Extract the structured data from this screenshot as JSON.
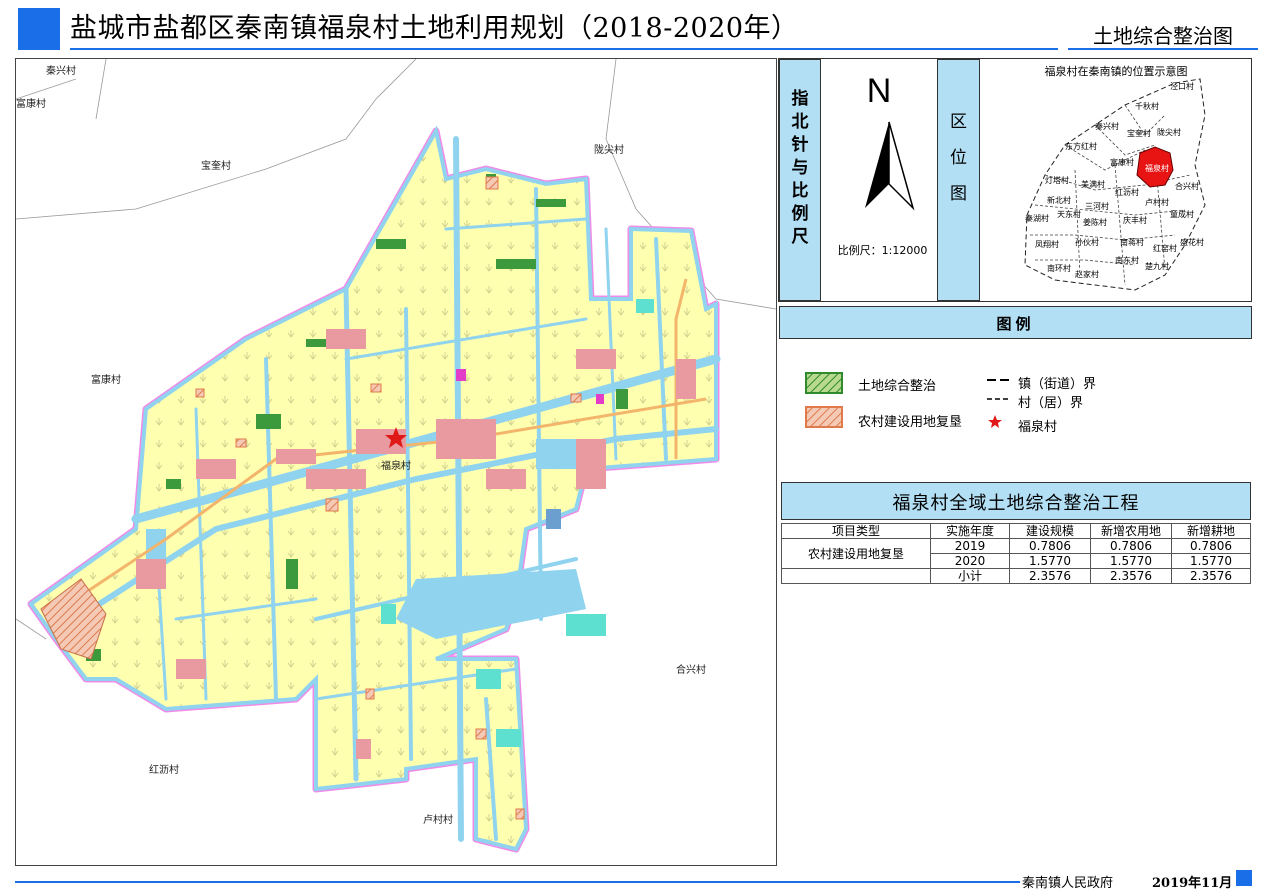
{
  "header": {
    "title": "盐城市盐都区秦南镇福泉村土地利用规划（2018-2020年）",
    "subtitle": "土地综合整治图"
  },
  "map": {
    "village_labels": {
      "qinxing": "秦兴村",
      "fukang_top": "富康村",
      "baokui": "宝奎村",
      "longjian": "陇尖村",
      "fukang": "富康村",
      "fuquan": "福泉村",
      "hexing": "合兴村",
      "hongli": "红沥村",
      "lucun": "卢村村"
    },
    "colors": {
      "farmland": "#ffffb0",
      "water": "#8fd3ef",
      "boundary": "#f08ce8",
      "road": "#f2b56b",
      "settlement": "#e89aa0",
      "integration": "#3c9a3c"
    }
  },
  "compass": {
    "label": "指北针与比例尺",
    "north": "N",
    "scale": "比例尺：1:12000"
  },
  "location": {
    "label": "区位图",
    "title": "福泉村在秦南镇的位置示意图",
    "villages": [
      "泾口村",
      "千秋村",
      "秦兴村",
      "宝奎村",
      "陇尖村",
      "东方红村",
      "富康村",
      "福泉村",
      "灯塔村",
      "美满村",
      "合兴村",
      "红沥村",
      "卢村村",
      "新北村",
      "三河村",
      "童成村",
      "庆丰村",
      "秦湖村",
      "天东村",
      "姜陈村",
      "凤翔村",
      "孙伙村",
      "南蒋村",
      "盛花村",
      "红窑村",
      "南环村",
      "南东村",
      "赵家村",
      "楚九村"
    ]
  },
  "legend": {
    "title": "图例",
    "items": {
      "land_integration": "土地综合整治",
      "rural_reclaim": "农村建设用地复垦",
      "town_boundary": "镇（街道）界",
      "village_boundary": "村（居）界",
      "village_marker": "福泉村"
    }
  },
  "project": {
    "title": "福泉村全域土地综合整治工程",
    "headers": [
      "项目类型",
      "实施年度",
      "建设规模",
      "新增农用地",
      "新增耕地"
    ],
    "type": "农村建设用地复垦",
    "rows": [
      {
        "year": "2019",
        "scale": "0.7806",
        "farm": "0.7806",
        "arable": "0.7806"
      },
      {
        "year": "2020",
        "scale": "1.5770",
        "farm": "1.5770",
        "arable": "1.5770"
      },
      {
        "year": "小计",
        "scale": "2.3576",
        "farm": "2.3576",
        "arable": "2.3576"
      }
    ]
  },
  "footer": {
    "org": "秦南镇人民政府",
    "date": "2019年11月"
  }
}
